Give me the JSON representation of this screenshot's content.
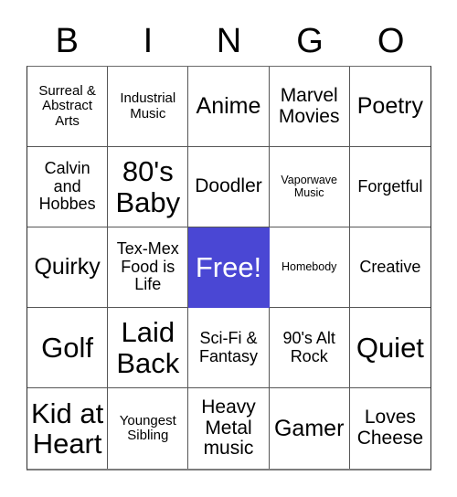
{
  "card": {
    "header": {
      "letters": [
        "B",
        "I",
        "N",
        "G",
        "O"
      ]
    },
    "cells": [
      {
        "text": "Surreal & Abstract Arts",
        "size": "s-sm",
        "free": false
      },
      {
        "text": "Industrial Music",
        "size": "s-sm",
        "free": false
      },
      {
        "text": "Anime",
        "size": "s-xl",
        "free": false
      },
      {
        "text": "Marvel Movies",
        "size": "s-lg",
        "free": false
      },
      {
        "text": "Poetry",
        "size": "s-xl",
        "free": false
      },
      {
        "text": "Calvin and Hobbes",
        "size": "s-md",
        "free": false
      },
      {
        "text": "80's Baby",
        "size": "s-xxl",
        "free": false
      },
      {
        "text": "Doodler",
        "size": "s-lg",
        "free": false
      },
      {
        "text": "Vaporwave Music",
        "size": "s-xs",
        "free": false
      },
      {
        "text": "Forgetful",
        "size": "s-md",
        "free": false
      },
      {
        "text": "Quirky",
        "size": "s-xl",
        "free": false
      },
      {
        "text": "Tex-Mex Food is Life",
        "size": "s-md",
        "free": false
      },
      {
        "text": "Free!",
        "size": "s-xxl",
        "free": true
      },
      {
        "text": "Homebody",
        "size": "s-xs",
        "free": false
      },
      {
        "text": "Creative",
        "size": "s-md",
        "free": false
      },
      {
        "text": "Golf",
        "size": "s-xxl",
        "free": false
      },
      {
        "text": "Laid Back",
        "size": "s-xxl",
        "free": false
      },
      {
        "text": "Sci-Fi & Fantasy",
        "size": "s-md",
        "free": false
      },
      {
        "text": "90's Alt Rock",
        "size": "s-md",
        "free": false
      },
      {
        "text": "Quiet",
        "size": "s-xxl",
        "free": false
      },
      {
        "text": "Kid at Heart",
        "size": "s-xxl",
        "free": false
      },
      {
        "text": "Youngest Sibling",
        "size": "s-sm",
        "free": false
      },
      {
        "text": "Heavy Metal music",
        "size": "s-lg",
        "free": false
      },
      {
        "text": "Gamer",
        "size": "s-xl",
        "free": false
      },
      {
        "text": "Loves Cheese",
        "size": "s-lg",
        "free": false
      }
    ],
    "colors": {
      "free_space_background": "#4a47d4",
      "free_space_text": "#ffffff",
      "grid_border": "#565656",
      "card_background": "#ffffff",
      "text": "#000000"
    }
  }
}
